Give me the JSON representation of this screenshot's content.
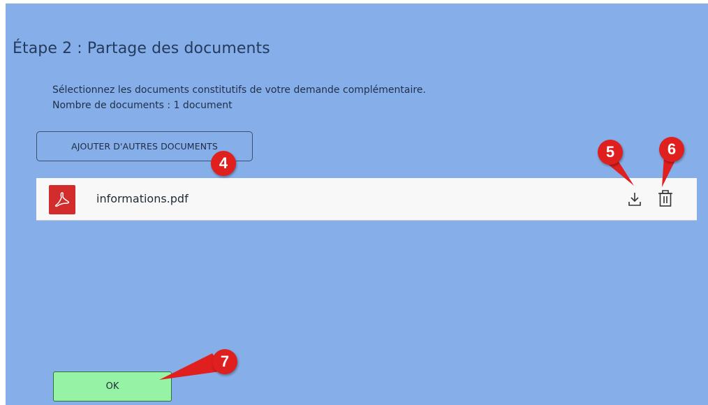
{
  "step": {
    "title": "Étape 2 : Partage des documents",
    "instruction": "Sélectionnez les documents constitutifs de votre demande complémentaire.",
    "count_text": "Nombre de documents : 1 document"
  },
  "actions": {
    "add_documents_label": "AJOUTER D'AUTRES DOCUMENTS",
    "ok_label": "OK"
  },
  "files": [
    {
      "name": "informations.pdf",
      "icon": "pdf-icon"
    }
  ],
  "row_actions": {
    "download_icon": "download-icon",
    "delete_icon": "trash-icon"
  },
  "markers": [
    "4",
    "5",
    "6",
    "7"
  ],
  "colors": {
    "background": "#86aee8",
    "row_background": "#f8f8f8",
    "pdf_red": "#d32c2c",
    "marker_red": "#e01f1f",
    "ok_green": "#96f3a6"
  }
}
